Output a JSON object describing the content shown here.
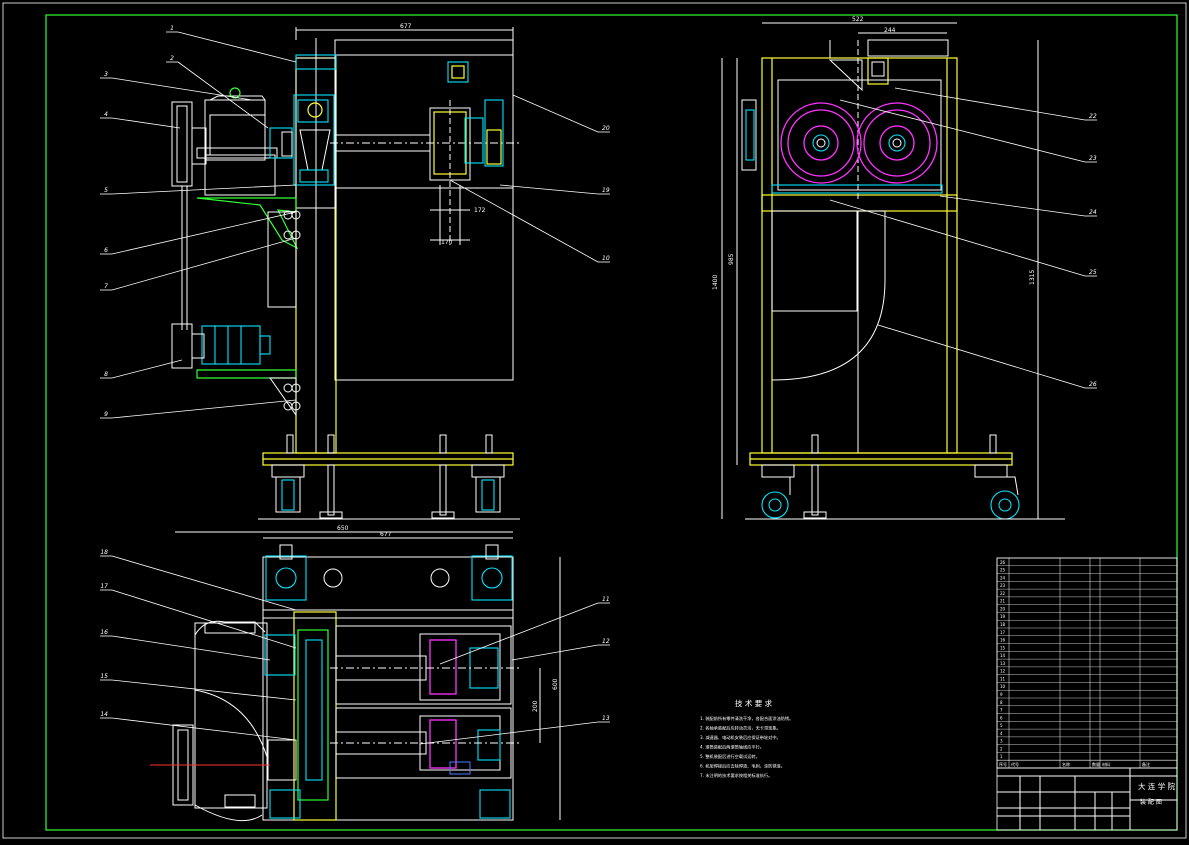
{
  "drawing": {
    "frame_color": "#33ff33",
    "colors": {
      "outline": "#ffffff",
      "frame": "#ffff33",
      "accent": "#33ff33",
      "cyan": "#00e5ff",
      "roller": "#ff33ff",
      "center": "#ff3333"
    }
  },
  "front_view": {
    "dims": {
      "width": "677",
      "d1": "170",
      "d2": "172"
    },
    "callouts": [
      "1",
      "2",
      "3",
      "4",
      "5",
      "6",
      "7",
      "8",
      "9",
      "10",
      "19",
      "20"
    ]
  },
  "side_view": {
    "dims": {
      "w1": "522",
      "w2": "244",
      "h1": "1400",
      "h2": "985",
      "h3": "1315"
    },
    "callouts": [
      "22",
      "23",
      "24",
      "25",
      "26"
    ]
  },
  "top_view": {
    "dims": {
      "w1": "650",
      "w2": "677",
      "h1": "600",
      "h2": "200"
    },
    "callouts": [
      "18",
      "17",
      "16",
      "15",
      "14",
      "13",
      "12",
      "11"
    ]
  },
  "notes": {
    "heading": "技 术 要 求",
    "items": [
      "1. 装配前所有零件清洗干净，各配合面涂油防锈。",
      "2. 各轴承装配后应转动灵活，无卡滞现象。",
      "3. 减速器、电动机安装后应保证带轮对中。",
      "4. 滚筒装配后两滚筒轴线应平行。",
      "5. 整机装配后进行空载试运转。",
      "6. 机架焊接后应去除焊渣、毛刺，涂防锈漆。",
      "7. 未注明的技术要求按相关标准执行。"
    ]
  },
  "title_block": {
    "school": "大 连 学 院",
    "title": "装 配 图"
  },
  "bom_rows": [
    "26",
    "25",
    "24",
    "23",
    "22",
    "21",
    "20",
    "19",
    "18",
    "17",
    "16",
    "15",
    "14",
    "13",
    "12",
    "11",
    "10",
    "9",
    "8",
    "7",
    "6",
    "5",
    "4",
    "3",
    "2",
    "1"
  ],
  "bom_header": [
    "序号",
    "代号",
    "名称",
    "数量",
    "材料",
    "备注"
  ]
}
